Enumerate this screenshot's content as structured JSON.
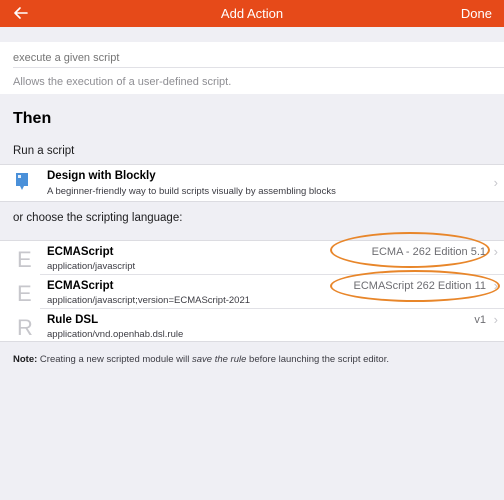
{
  "nav": {
    "title": "Add Action",
    "done_label": "Done",
    "accent": "#e64a19"
  },
  "top": {
    "input_placeholder": "execute a given script",
    "description": "Allows the execution of a user-defined script."
  },
  "section": {
    "title": "Then",
    "run_label": "Run a script"
  },
  "blockly": {
    "icon": "puzzle-block-icon",
    "title": "Design with Blockly",
    "subtitle": "A beginner-friendly way to build scripts visually by assembling blocks"
  },
  "choose_label": "or choose the scripting language:",
  "languages": [
    {
      "letter": "E",
      "title": "ECMAScript",
      "subtitle": "application/javascript",
      "after": "ECMA - 262 Edition 5.1",
      "highlighted": true
    },
    {
      "letter": "E",
      "title": "ECMAScript",
      "subtitle": "application/javascript;version=ECMAScript-2021",
      "after": "ECMAScript 262 Edition 11",
      "highlighted": true
    },
    {
      "letter": "R",
      "title": "Rule DSL",
      "subtitle": "application/vnd.openhab.dsl.rule",
      "after": "v1",
      "highlighted": false
    }
  ],
  "note": {
    "prefix": "Note:",
    "text1": " Creating a new scripted module will ",
    "emphasis": "save the rule",
    "text2": " before launching the script editor."
  },
  "highlight_color": "#e8862a"
}
